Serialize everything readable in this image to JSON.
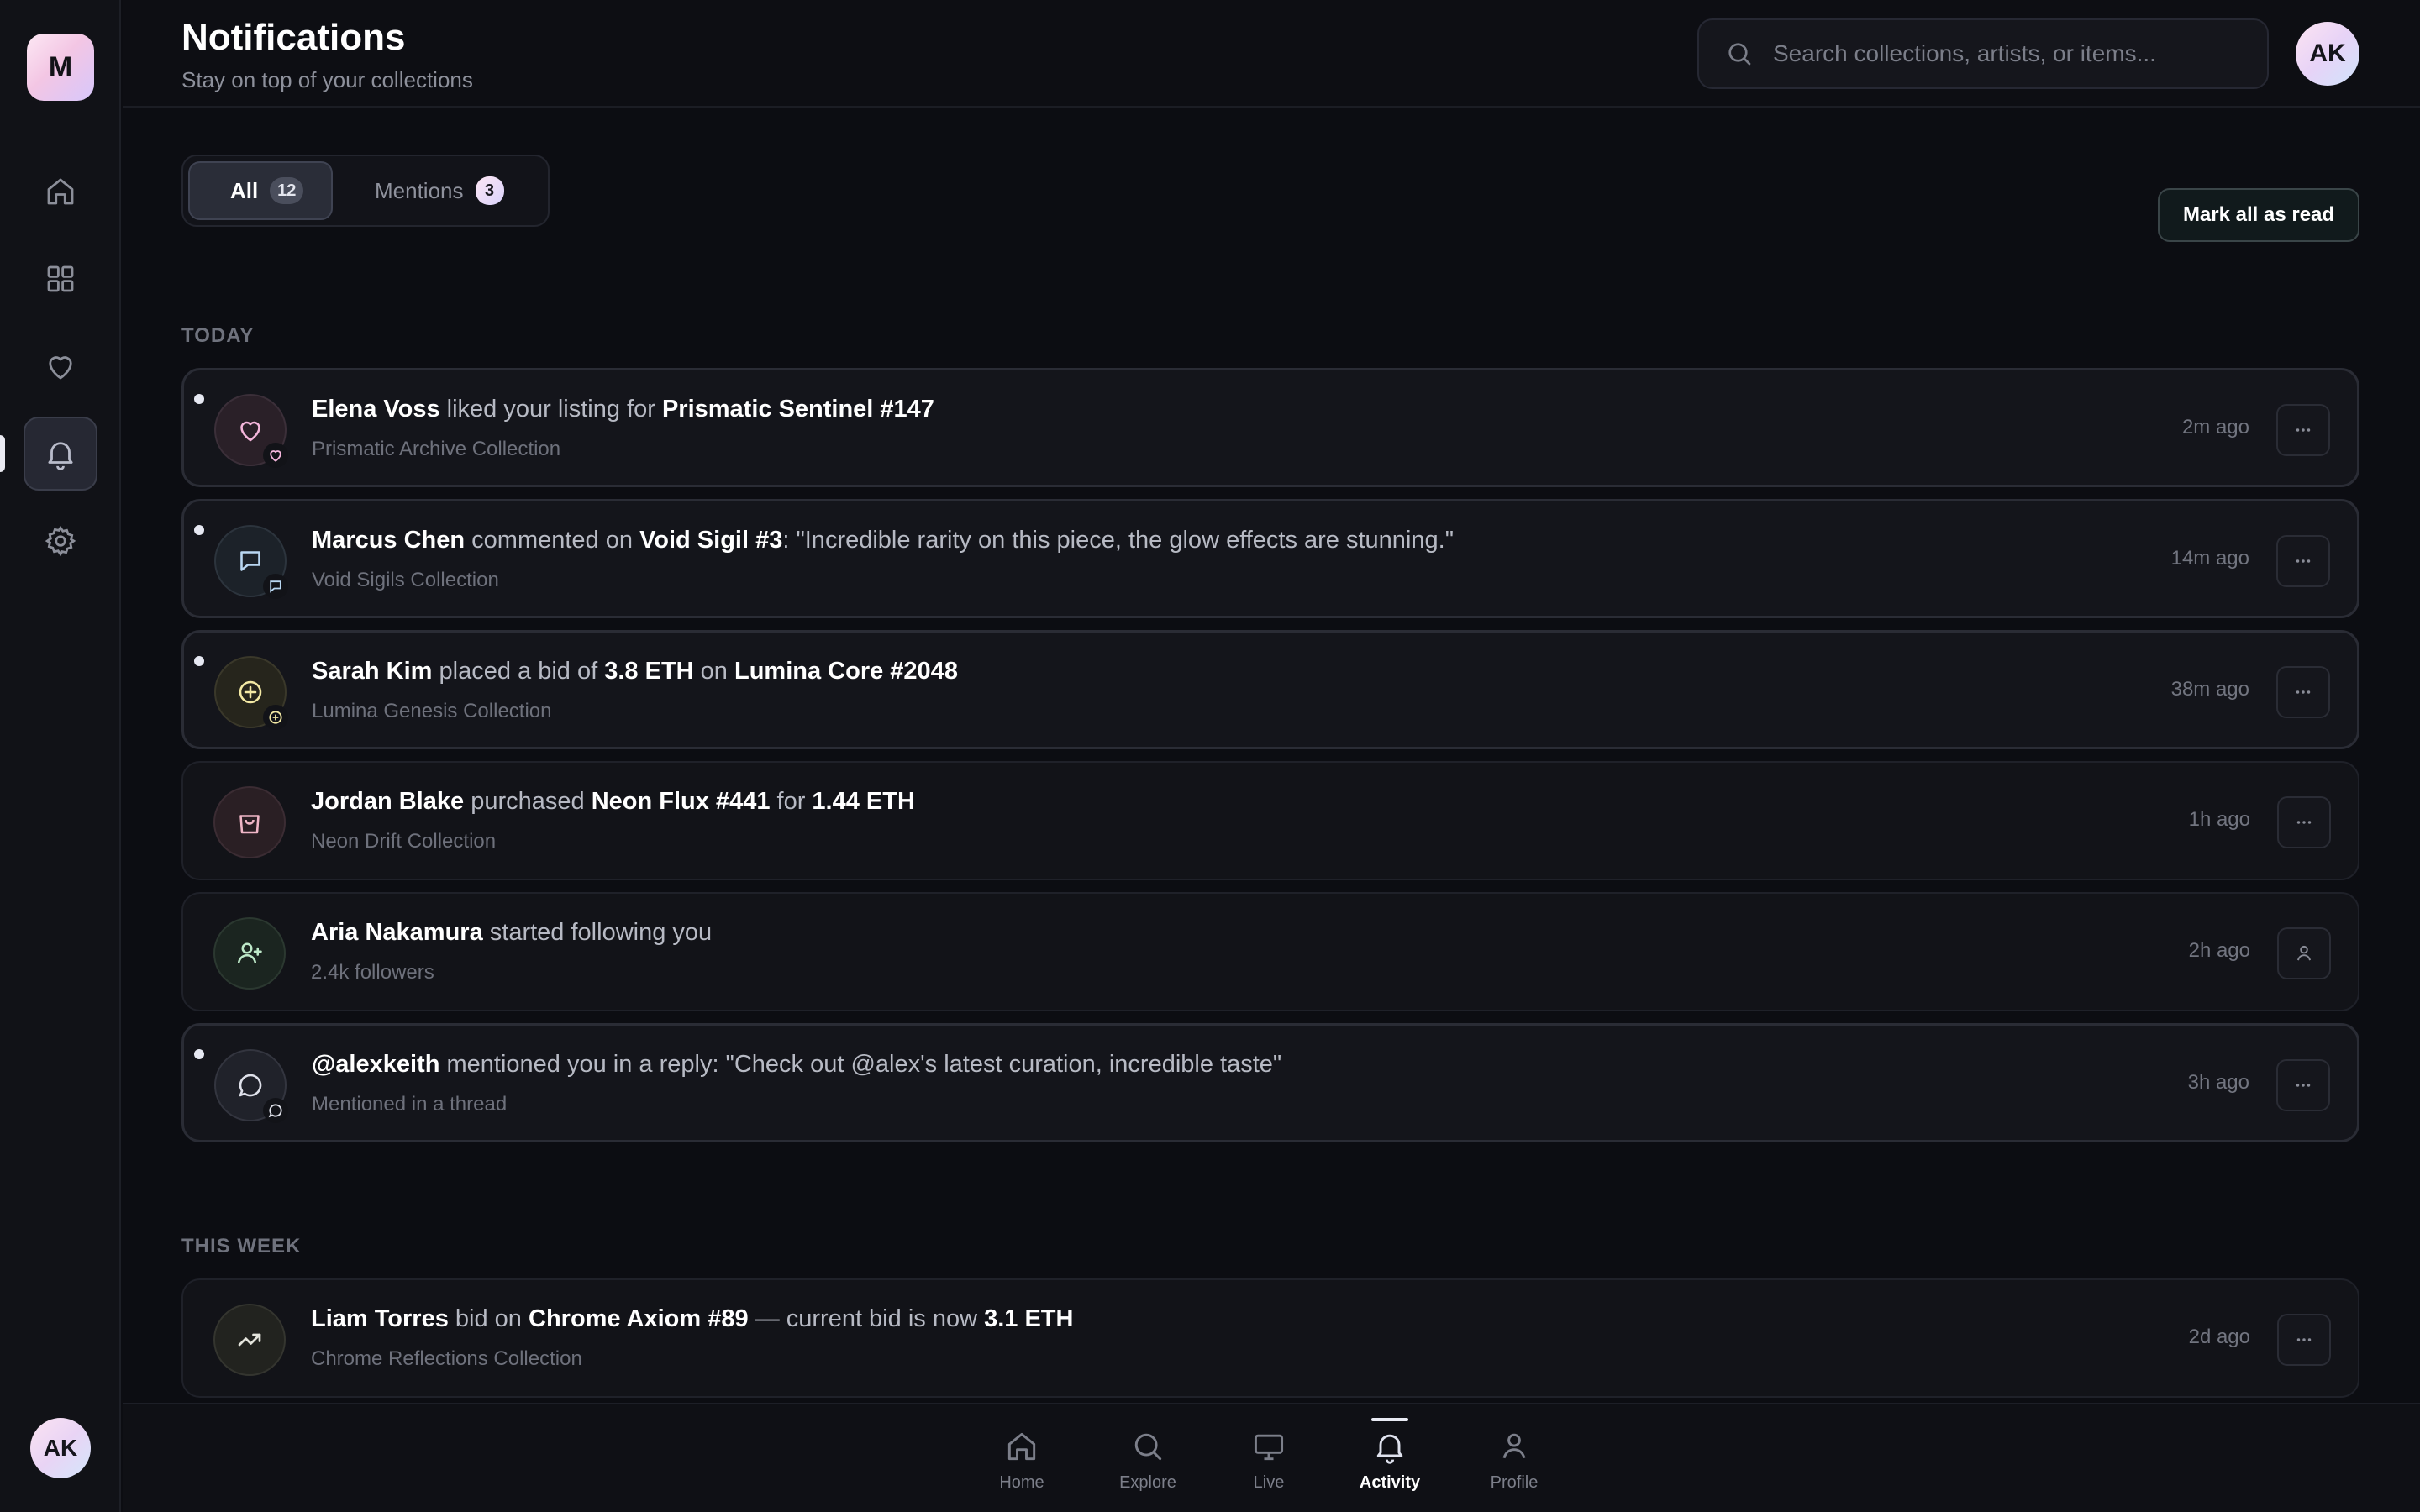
{
  "brand": {
    "initial": "M"
  },
  "header": {
    "title": "Notifications",
    "subtitle": "Stay on top of your collections",
    "search_placeholder": "Search collections, artists, or items...",
    "avatar": "AK"
  },
  "sidebar": {
    "items": [
      {
        "name": "home",
        "icon": "home-icon"
      },
      {
        "name": "grid",
        "icon": "grid-icon"
      },
      {
        "name": "favorites",
        "icon": "heart-icon"
      },
      {
        "name": "notifications",
        "icon": "bell-icon",
        "active": true
      },
      {
        "name": "settings",
        "icon": "gear-icon"
      }
    ],
    "avatar": "AK"
  },
  "tabs": [
    {
      "label": "All",
      "count": "12",
      "active": true
    },
    {
      "label": "Mentions",
      "count": "3",
      "active": false
    }
  ],
  "actions": {
    "mark_all": "Mark all as read"
  },
  "sections": {
    "today": "TODAY",
    "this_week": "THIS WEEK"
  },
  "notifications": [
    {
      "icon": "heart-icon",
      "unread": true,
      "actor": "Elena Voss",
      "t1": "liked your listing for",
      "target": "Prismatic Sentinel #147",
      "sub": "Prismatic Archive Collection",
      "time": "2m ago",
      "action_icon": "more-icon"
    },
    {
      "icon": "comment-icon",
      "unread": true,
      "actor": "Marcus Chen",
      "t1": "commented on",
      "target": "Void Sigil #3",
      "t2": ": \"Incredible rarity on this piece, the glow effects are stunning.\"",
      "sub": "Void Sigils Collection",
      "time": "14m ago",
      "action_icon": "more-icon"
    },
    {
      "icon": "bid-icon",
      "unread": true,
      "actor": "Sarah Kim",
      "t1": "placed a bid of",
      "amount": "3.8 ETH",
      "t2": "on",
      "target": "Lumina Core #2048",
      "sub": "Lumina Genesis Collection",
      "time": "38m ago",
      "action_icon": "more-icon"
    },
    {
      "icon": "bag-icon",
      "unread": false,
      "actor": "Jordan Blake",
      "t1": "purchased",
      "target": "Neon Flux #441",
      "t2": "for",
      "amount": "1.44 ETH",
      "sub": "Neon Drift Collection",
      "time": "1h ago",
      "action_icon": "more-icon"
    },
    {
      "icon": "user-plus-icon",
      "unread": false,
      "actor": "Aria Nakamura",
      "t1": "started following you",
      "sub": "2.4k followers",
      "time": "2h ago",
      "action_icon": "user-icon"
    },
    {
      "icon": "mention-icon",
      "unread": true,
      "actor": "@alexkeith",
      "t1": "mentioned you in a reply: \"Check out @alex's latest curation, incredible taste\"",
      "sub": "Mentioned in a thread",
      "time": "3h ago",
      "action_icon": "more-icon"
    },
    {
      "icon": "trend-icon",
      "unread": false,
      "actor": "Liam Torres",
      "t1": "bid on",
      "target": "Chrome Axiom #89",
      "t2": "— current bid is now",
      "amount": "3.1 ETH",
      "sub": "Chrome Reflections Collection",
      "time": "2d ago",
      "action_icon": "more-icon"
    }
  ],
  "bottom_nav": [
    {
      "label": "Home",
      "icon": "home-icon"
    },
    {
      "label": "Explore",
      "icon": "search-icon"
    },
    {
      "label": "Live",
      "icon": "monitor-icon"
    },
    {
      "label": "Activity",
      "icon": "bell-icon",
      "active": true
    },
    {
      "label": "Profile",
      "icon": "user-icon"
    }
  ],
  "colors": {
    "background": "#0c0d12",
    "heart_accent": "#f5b6dc",
    "comment_accent": "#b9d7f2",
    "bid_accent": "#f3e9a4",
    "bag_accent": "#f0b6c7",
    "follow_accent": "#bde8c8"
  }
}
